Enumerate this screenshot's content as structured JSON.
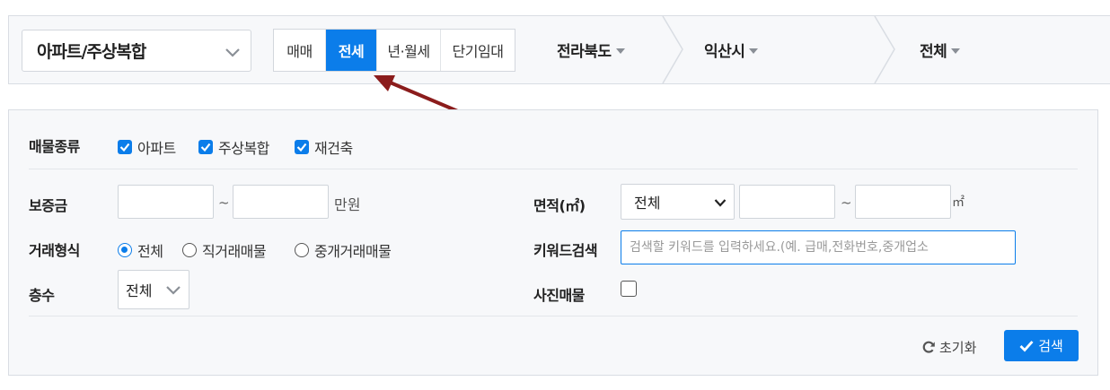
{
  "topbar": {
    "property_type": "아파트/주상복합",
    "deal_tabs": [
      "매매",
      "전세",
      "년·월세",
      "단기임대"
    ],
    "active_deal_tab": "전세",
    "regions": [
      "전라북도",
      "익산시",
      "전체"
    ]
  },
  "filters": {
    "property_kind": {
      "label": "매물종류",
      "options": [
        {
          "label": "아파트",
          "checked": true
        },
        {
          "label": "주상복합",
          "checked": true
        },
        {
          "label": "재건축",
          "checked": true
        }
      ]
    },
    "deposit": {
      "label": "보증금",
      "min": "",
      "max": "",
      "tilde": "~",
      "unit": "만원"
    },
    "area": {
      "label": "면적(㎡)",
      "select": "전체",
      "min": "",
      "max": "",
      "tilde": "~",
      "unit": "㎡"
    },
    "deal_method": {
      "label": "거래형식",
      "options": [
        {
          "label": "전체",
          "selected": true
        },
        {
          "label": "직거래매물",
          "selected": false
        },
        {
          "label": "중개거래매물",
          "selected": false
        }
      ]
    },
    "keyword": {
      "label": "키워드검색",
      "value": "",
      "placeholder": "검색할 키워드를 입력하세요.(예. 급매,전화번호,중개업소"
    },
    "floor": {
      "label": "층수",
      "select": "전체"
    },
    "photo": {
      "label": "사진매물",
      "checked": false
    }
  },
  "actions": {
    "reset": "초기화",
    "search": "검색"
  },
  "colors": {
    "accent": "#0b7dea",
    "annotation_arrow": "#8b1c1c"
  }
}
